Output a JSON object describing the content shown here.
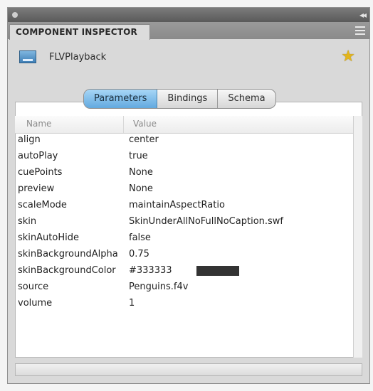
{
  "panel": {
    "title": "COMPONENT INSPECTOR",
    "component_name": "FLVPlayback"
  },
  "tabs": [
    {
      "label": "Parameters",
      "active": true
    },
    {
      "label": "Bindings",
      "active": false
    },
    {
      "label": "Schema",
      "active": false
    }
  ],
  "grid": {
    "headers": {
      "name": "Name",
      "value": "Value"
    },
    "rows": [
      {
        "name": "align",
        "value": "center"
      },
      {
        "name": "autoPlay",
        "value": "true"
      },
      {
        "name": "cuePoints",
        "value": "None"
      },
      {
        "name": "preview",
        "value": "None"
      },
      {
        "name": "scaleMode",
        "value": "maintainAspectRatio"
      },
      {
        "name": "skin",
        "value": "SkinUnderAllNoFullNoCaption.swf"
      },
      {
        "name": "skinAutoHide",
        "value": "false"
      },
      {
        "name": "skinBackgroundAlpha",
        "value": "0.75"
      },
      {
        "name": "skinBackgroundColor",
        "value": "#333333"
      },
      {
        "name": "source",
        "value": "Penguins.f4v"
      },
      {
        "name": "volume",
        "value": "1"
      }
    ]
  },
  "colors": {
    "active_tab": "#62a9df",
    "swatch": "#333333"
  },
  "icons": {
    "component": "flvplayback-component-icon",
    "star": "star-icon",
    "menu": "panel-menu-icon"
  }
}
